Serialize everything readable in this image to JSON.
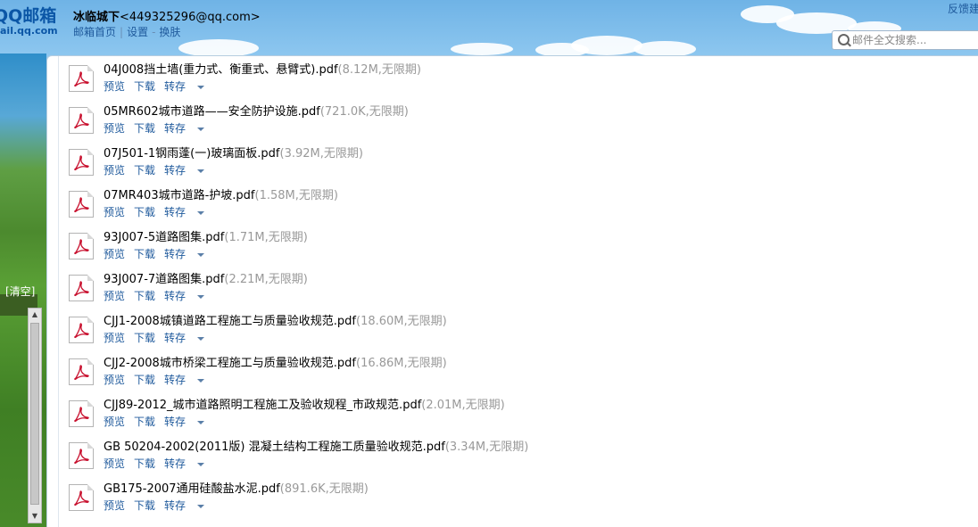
{
  "header": {
    "logo_main": "QQ邮箱",
    "logo_sub": "ail.qq.com",
    "user_name": "冰临城下",
    "user_email": "<449325296@qq.com>",
    "nav_home": "邮箱首页",
    "nav_settings": "设置",
    "nav_skin": "换肤",
    "feedback": "反馈建",
    "search_placeholder": "邮件全文搜索..."
  },
  "sidebar": {
    "clear_label": "[清空]"
  },
  "actions": {
    "preview": "预览",
    "download": "下载",
    "save": "转存"
  },
  "files": [
    {
      "name": "04J008挡土墙(重力式、衡重式、悬臂式).pdf",
      "meta": "(8.12M,无限期)"
    },
    {
      "name": "05MR602城市道路——安全防护设施.pdf",
      "meta": "(721.0K,无限期)"
    },
    {
      "name": "07J501-1钢雨蓬(一)玻璃面板.pdf",
      "meta": "(3.92M,无限期)"
    },
    {
      "name": "07MR403城市道路-护坡.pdf",
      "meta": "(1.58M,无限期)"
    },
    {
      "name": "93J007-5道路图集.pdf",
      "meta": "(1.71M,无限期)"
    },
    {
      "name": "93J007-7道路图集.pdf",
      "meta": "(2.21M,无限期)"
    },
    {
      "name": "CJJ1-2008城镇道路工程施工与质量验收规范.pdf",
      "meta": "(18.60M,无限期)"
    },
    {
      "name": "CJJ2-2008城市桥梁工程施工与质量验收规范.pdf",
      "meta": "(16.86M,无限期)"
    },
    {
      "name": "CJJ89-2012_城市道路照明工程施工及验收规程_市政规范.pdf",
      "meta": "(2.01M,无限期)"
    },
    {
      "name": "GB 50204-2002(2011版) 混凝土结构工程施工质量验收规范.pdf",
      "meta": "(3.34M,无限期)"
    },
    {
      "name": "GB175-2007通用硅酸盐水泥.pdf",
      "meta": "(891.6K,无限期)"
    }
  ]
}
